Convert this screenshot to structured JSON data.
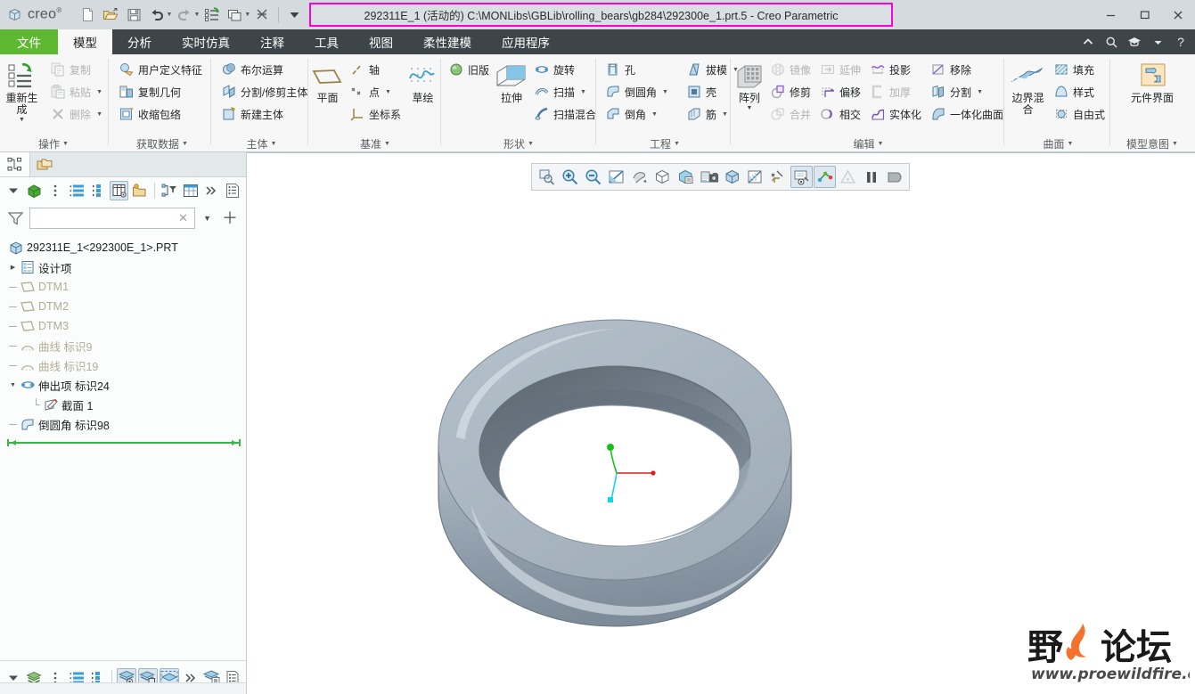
{
  "window": {
    "title": "292311E_1 (活动的) C:\\MONLibs\\GBLib\\rolling_bears\\gb284\\292300e_1.prt.5 - Creo Parametric",
    "brand": "creo",
    "brand_sup": "®",
    "minimize_label": "–",
    "maximize_label": "□",
    "close_label": "✕",
    "title_highlight_color": "#ff00d4"
  },
  "quick_access": [
    {
      "name": "new-file-icon",
      "label": "新建"
    },
    {
      "name": "open-file-icon",
      "label": "打开"
    },
    {
      "name": "save-icon",
      "label": "保存"
    },
    {
      "name": "undo-icon",
      "label": "撤消"
    },
    {
      "name": "redo-icon",
      "label": "重做"
    },
    {
      "name": "regenerate-icon",
      "label": "重新生成"
    },
    {
      "name": "window-switch-icon",
      "label": "窗口"
    },
    {
      "name": "close-window-icon",
      "label": "关闭"
    },
    {
      "name": "customize-qat-icon",
      "label": "自定义快速访问工具栏"
    }
  ],
  "tabs": [
    {
      "label": "文件",
      "kind": "file"
    },
    {
      "label": "模型",
      "kind": "active"
    },
    {
      "label": "分析",
      "kind": "normal"
    },
    {
      "label": "实时仿真",
      "kind": "normal"
    },
    {
      "label": "注释",
      "kind": "normal"
    },
    {
      "label": "工具",
      "kind": "normal"
    },
    {
      "label": "视图",
      "kind": "normal"
    },
    {
      "label": "柔性建模",
      "kind": "normal"
    },
    {
      "label": "应用程序",
      "kind": "normal"
    }
  ],
  "tab_right_icons": [
    {
      "name": "collapse-ribbon-icon"
    },
    {
      "name": "search-icon"
    },
    {
      "name": "learning-connector-icon"
    },
    {
      "name": "learning-dropdown-caret-icon"
    },
    {
      "name": "help-icon"
    }
  ],
  "ribbon": {
    "groups": [
      {
        "name": "operations",
        "label": "操作",
        "big": {
          "label": "重新生成",
          "icon": "regenerate-icon",
          "has_caret": true
        },
        "items": [
          {
            "label": "复制",
            "icon": "copy-icon",
            "disabled": true,
            "caret": false
          },
          {
            "label": "粘贴",
            "icon": "paste-icon",
            "disabled": true,
            "caret": true
          },
          {
            "label": "删除",
            "icon": "delete-icon",
            "disabled": true,
            "caret": true
          }
        ]
      },
      {
        "name": "get-data",
        "label": "获取数据",
        "items": [
          {
            "label": "用户定义特征",
            "icon": "udf-icon",
            "disabled": false,
            "caret": false
          },
          {
            "label": "复制几何",
            "icon": "copy-geometry-icon",
            "disabled": false,
            "caret": false
          },
          {
            "label": "收缩包络",
            "icon": "shrinkwrap-icon",
            "disabled": false,
            "caret": false
          }
        ]
      },
      {
        "name": "body",
        "label": "主体",
        "items": [
          {
            "label": "布尔运算",
            "icon": "boolean-icon",
            "disabled": false,
            "caret": false
          },
          {
            "label": "分割/修剪主体",
            "icon": "split-trim-body-icon",
            "disabled": false,
            "caret": false
          },
          {
            "label": "新建主体",
            "icon": "new-body-icon",
            "disabled": false,
            "caret": false
          }
        ]
      },
      {
        "name": "datum",
        "label": "基准",
        "plane": {
          "label": "平面",
          "icon": "datum-plane-icon"
        },
        "items": [
          {
            "label": "轴",
            "icon": "datum-axis-icon",
            "disabled": false,
            "caret": false
          },
          {
            "label": "点",
            "icon": "datum-point-icon",
            "disabled": false,
            "caret": true
          },
          {
            "label": "坐标系",
            "icon": "coordinate-system-icon",
            "disabled": false,
            "caret": false
          }
        ],
        "sketch": {
          "label": "草绘",
          "icon": "sketch-icon"
        }
      },
      {
        "name": "shapes",
        "label": "形状",
        "legacy": {
          "label": "旧版",
          "icon": "legacy-icon"
        },
        "extrude": {
          "label": "拉伸",
          "icon": "extrude-icon"
        },
        "items": [
          {
            "label": "旋转",
            "icon": "revolve-icon",
            "disabled": false,
            "caret": false
          },
          {
            "label": "扫描",
            "icon": "sweep-icon",
            "disabled": false,
            "caret": true
          },
          {
            "label": "扫描混合",
            "icon": "swept-blend-icon",
            "disabled": false,
            "caret": false
          }
        ]
      },
      {
        "name": "engineering",
        "label": "工程",
        "col1": [
          {
            "label": "孔",
            "icon": "hole-icon",
            "disabled": false,
            "caret": false
          },
          {
            "label": "倒圆角",
            "icon": "round-icon",
            "disabled": false,
            "caret": true
          },
          {
            "label": "倒角",
            "icon": "chamfer-icon",
            "disabled": false,
            "caret": true
          }
        ],
        "col2": [
          {
            "label": "拔模",
            "icon": "draft-icon",
            "disabled": false,
            "caret": true
          },
          {
            "label": "壳",
            "icon": "shell-icon",
            "disabled": false,
            "caret": false
          },
          {
            "label": "筋",
            "icon": "rib-icon",
            "disabled": false,
            "caret": true
          }
        ]
      },
      {
        "name": "edit",
        "label": "编辑",
        "pattern": {
          "label": "阵列",
          "icon": "pattern-icon",
          "has_caret": true
        },
        "col1": [
          {
            "label": "镜像",
            "icon": "mirror-icon",
            "disabled": true,
            "caret": false
          },
          {
            "label": "修剪",
            "icon": "trim-icon",
            "disabled": false,
            "caret": false
          },
          {
            "label": "合并",
            "icon": "merge-icon",
            "disabled": true,
            "caret": false
          }
        ],
        "col2": [
          {
            "label": "延伸",
            "icon": "extend-icon",
            "disabled": true,
            "caret": false
          },
          {
            "label": "偏移",
            "icon": "offset-icon",
            "disabled": false,
            "caret": false
          },
          {
            "label": "相交",
            "icon": "intersect-icon",
            "disabled": false,
            "caret": false
          }
        ],
        "col3": [
          {
            "label": "投影",
            "icon": "project-icon",
            "disabled": false,
            "caret": false
          },
          {
            "label": "加厚",
            "icon": "thicken-icon",
            "disabled": true,
            "caret": false
          },
          {
            "label": "实体化",
            "icon": "solidify-icon",
            "disabled": false,
            "caret": false
          }
        ],
        "col4": [
          {
            "label": "移除",
            "icon": "remove-surface-icon",
            "disabled": false,
            "caret": false
          },
          {
            "label": "分割",
            "icon": "split-surface-icon",
            "disabled": false,
            "caret": true
          },
          {
            "label": "一体化曲面",
            "icon": "unified-surface-icon",
            "disabled": false,
            "caret": false
          }
        ]
      },
      {
        "name": "surfaces",
        "label": "曲面",
        "boundary_blend": {
          "label": "边界混合",
          "icon": "boundary-blend-icon"
        },
        "items": [
          {
            "label": "填充",
            "icon": "fill-icon",
            "disabled": false,
            "caret": false
          },
          {
            "label": "样式",
            "icon": "style-icon",
            "disabled": false,
            "caret": false
          },
          {
            "label": "自由式",
            "icon": "freestyle-icon",
            "disabled": false,
            "caret": false
          }
        ]
      },
      {
        "name": "model-intent",
        "label": "模型意图",
        "big": {
          "label": "元件界面",
          "icon": "component-interface-icon",
          "has_caret": false
        }
      }
    ]
  },
  "tree_panel": {
    "tabs": [
      {
        "name": "model-tree-tab",
        "icon": "model-tree-icon",
        "active": true
      },
      {
        "name": "layer-tree-tab",
        "icon": "folder-browser-icon",
        "active": false
      }
    ],
    "toolbar": [
      {
        "name": "tree-settings-caret-icon"
      },
      {
        "name": "model-display-icon"
      },
      {
        "name": "tree-overflow-icon"
      },
      {
        "name": "tree-list-icon"
      },
      {
        "name": "tree-expand-icon"
      },
      {
        "name": "tree-columns-icon",
        "on": true
      },
      {
        "name": "open-folder-icon"
      },
      {
        "name": "tree-filter-icon"
      },
      {
        "name": "tree-columns-config-icon"
      },
      {
        "name": "more-chevron-icon"
      },
      {
        "name": "tree-report-icon"
      }
    ],
    "search": {
      "value": "",
      "placeholder": ""
    },
    "search_buttons": [
      {
        "name": "clear-search-icon"
      },
      {
        "name": "search-dropdown-caret-icon"
      },
      {
        "name": "add-search-icon"
      }
    ],
    "tree": [
      {
        "label": "292311E_1<292300E_1>.PRT",
        "icon": "part-icon",
        "indent": 0,
        "arrow": "none",
        "connector": "none",
        "dim": false
      },
      {
        "label": "设计项",
        "icon": "design-items-icon",
        "indent": 1,
        "arrow": "collapsed",
        "connector": "none",
        "dim": false
      },
      {
        "label": "DTM1",
        "icon": "datum-plane-icon",
        "indent": 1,
        "arrow": "none",
        "connector": "tee",
        "dim": true
      },
      {
        "label": "DTM2",
        "icon": "datum-plane-icon",
        "indent": 1,
        "arrow": "none",
        "connector": "tee",
        "dim": true
      },
      {
        "label": "DTM3",
        "icon": "datum-plane-icon",
        "indent": 1,
        "arrow": "none",
        "connector": "tee",
        "dim": true
      },
      {
        "label": "曲线 标识9",
        "icon": "curve-icon",
        "indent": 1,
        "arrow": "none",
        "connector": "tee",
        "dim": true
      },
      {
        "label": "曲线 标识19",
        "icon": "curve-icon",
        "indent": 1,
        "arrow": "none",
        "connector": "tee",
        "dim": true
      },
      {
        "label": "伸出项 标识24",
        "icon": "revolve-feature-icon",
        "indent": 1,
        "arrow": "expanded",
        "connector": "none",
        "dim": false
      },
      {
        "label": "截面 1",
        "icon": "section-icon",
        "indent": 2,
        "arrow": "none",
        "connector": "corner",
        "dim": false
      },
      {
        "label": "倒圆角 标识98",
        "icon": "round-feature-icon",
        "indent": 1,
        "arrow": "none",
        "connector": "tee",
        "dim": false
      }
    ],
    "insert_bar": {
      "name": "insert-here-bar",
      "color": "#3cb54a"
    },
    "bottom_toolbar": [
      {
        "name": "layer-settings-caret-icon"
      },
      {
        "name": "layers-icon"
      },
      {
        "name": "layer-overflow-icon"
      },
      {
        "name": "layer-list-icon"
      },
      {
        "name": "layer-expand-icon"
      },
      {
        "name": "display-layer-icon",
        "on": true
      },
      {
        "name": "hide-layer-icon",
        "on": true
      },
      {
        "name": "isolate-layer-icon",
        "on": true
      },
      {
        "name": "layer-more-chevron-icon"
      },
      {
        "name": "layer-report-icon"
      },
      {
        "name": "layer-props-icon"
      }
    ]
  },
  "graphics_toolbar": [
    {
      "name": "zoom-to-fit-icon",
      "disabled": false,
      "on": false
    },
    {
      "name": "zoom-in-icon",
      "disabled": false,
      "on": false
    },
    {
      "name": "zoom-out-icon",
      "disabled": false,
      "on": false
    },
    {
      "name": "refit-icon",
      "disabled": false,
      "on": false
    },
    {
      "name": "reorient-icon",
      "disabled": false,
      "on": false
    },
    {
      "name": "saved-orientations-icon",
      "disabled": false,
      "on": false
    },
    {
      "name": "view-manager-icon",
      "disabled": false,
      "on": false
    },
    {
      "name": "capture-image-icon",
      "disabled": false,
      "on": false
    },
    {
      "name": "display-style-icon",
      "disabled": false,
      "on": false
    },
    {
      "name": "appearance-icon",
      "disabled": false,
      "on": false
    },
    {
      "name": "datum-display-filters-icon",
      "disabled": false,
      "on": false
    },
    {
      "name": "annotation-display-icon",
      "disabled": false,
      "on": true
    },
    {
      "name": "spin-center-icon",
      "disabled": false,
      "on": true
    },
    {
      "name": "warning-icon",
      "disabled": true,
      "on": false
    },
    {
      "name": "pause-icon",
      "disabled": false,
      "on": false
    },
    {
      "name": "stop-icon",
      "disabled": false,
      "on": false
    }
  ],
  "model_view": {
    "name": "bearing-outer-ring-model",
    "description": "滚动轴承外圈三维模型",
    "body_color": "#aab7c4",
    "shadow_color": "#6d7880",
    "csys": {
      "name": "coordinate-system-triad",
      "x_axis_color": "#e01b1b",
      "y_axis_color": "#17c217",
      "z_axis_color": "#13d7e0"
    }
  },
  "watermark": {
    "name": "yehuo-forum-watermark",
    "text_cn": "野火论坛",
    "text_url": "www.proewildfire.cn",
    "flame_color": "#f4722b",
    "char_color": "#1a1a1a"
  }
}
